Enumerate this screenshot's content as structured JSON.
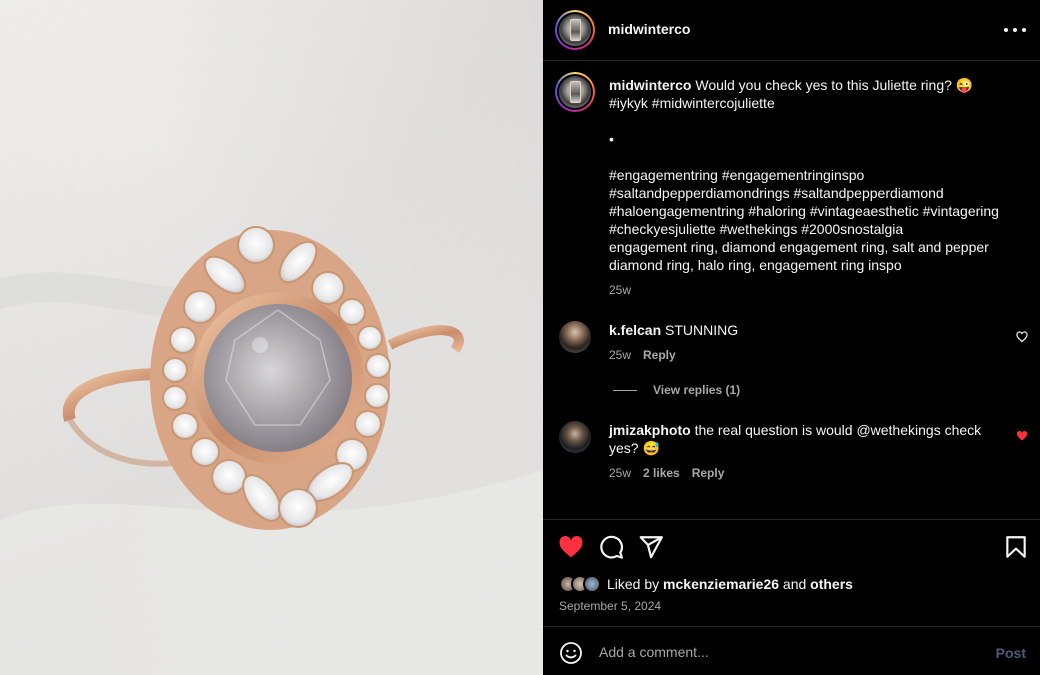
{
  "post": {
    "username": "midwinterco",
    "caption": {
      "username": "midwinterco",
      "text_line1": "Would you check yes to this Juliette ring? 😜",
      "text_line2": "#iykyk #midwintercojuliette",
      "bullet": "•",
      "hashtags": [
        "#engagementring #engagementringinspo",
        "#saltandpepperdiamondrings #saltandpepperdiamond",
        "#haloengagementring #haloring #vintageaesthetic #vintagering",
        "#checkyesjuliette #wethekings #2000snostalgia",
        "engagement ring, diamond engagement ring, salt and pepper",
        "diamond ring, halo ring, engagement ring inspo"
      ],
      "time": "25w"
    }
  },
  "comments": [
    {
      "username": "k.felcan",
      "text": "STUNNING",
      "time": "25w",
      "reply": "Reply",
      "liked": false,
      "view_replies": "View replies (1)"
    },
    {
      "username": "jmizakphoto",
      "text_line1": "the real question is would @wethekings check",
      "text_line2": "yes? 😅",
      "time": "25w",
      "likes": "2 likes",
      "reply": "Reply",
      "liked": true
    }
  ],
  "actions": {
    "liked_by_prefix": "Liked by",
    "liked_by_user": "mckenziemarie26",
    "liked_by_and": "and",
    "liked_by_others": "others",
    "date": "September 5, 2024"
  },
  "add_comment": {
    "placeholder": "Add a comment...",
    "post_label": "Post"
  },
  "colors": {
    "like_red": "#ff3040",
    "post_blue_disabled": "#4a5d7a",
    "secondary_text": "#a8a8a8"
  }
}
